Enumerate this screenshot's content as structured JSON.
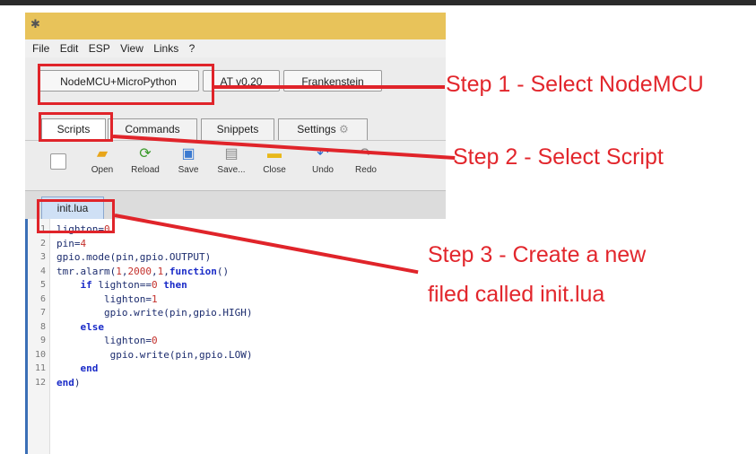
{
  "app": {
    "menu": [
      "File",
      "Edit",
      "ESP",
      "View",
      "Links",
      "?"
    ],
    "board_tabs": [
      "NodeMCU+MicroPython",
      "AT v0.20",
      "Frankenstein"
    ],
    "tabs": [
      "Scripts",
      "Commands",
      "Snippets",
      "Settings"
    ],
    "toolbar": [
      {
        "label": "Open",
        "icon": "open-folder-icon",
        "color": "#e8a51a"
      },
      {
        "label": "Reload",
        "icon": "reload-icon",
        "color": "#3a9a2a"
      },
      {
        "label": "Save",
        "icon": "save-icon",
        "color": "#3b7ad0"
      },
      {
        "label": "Save...",
        "icon": "save-as-icon",
        "color": "#888888"
      },
      {
        "label": "Close",
        "icon": "close-icon",
        "color": "#e8b81a"
      },
      {
        "label": "Undo",
        "icon": "undo-icon",
        "color": "#2a6ad0"
      },
      {
        "label": "Redo",
        "icon": "redo-icon",
        "color": "#888888"
      }
    ],
    "file_tab": "init.lua"
  },
  "code_lines": [
    {
      "n": "1",
      "text": "lighton=0"
    },
    {
      "n": "2",
      "text": "pin=4"
    },
    {
      "n": "3",
      "text": "gpio.mode(pin,gpio.OUTPUT)"
    },
    {
      "n": "4",
      "text": "tmr.alarm(1,2000,1,function()"
    },
    {
      "n": "5",
      "text": "    if lighton==0 then"
    },
    {
      "n": "6",
      "text": "        lighton=1"
    },
    {
      "n": "7",
      "text": "        gpio.write(pin,gpio.HIGH)"
    },
    {
      "n": "8",
      "text": "    else"
    },
    {
      "n": "9",
      "text": "        lighton=0"
    },
    {
      "n": "10",
      "text": "         gpio.write(pin,gpio.LOW)"
    },
    {
      "n": "11",
      "text": "    end"
    },
    {
      "n": "12",
      "text": "end)"
    }
  ],
  "annotations": {
    "step1": "Step 1 - Select NodeMCU",
    "step2": "Step 2 - Select Script",
    "step3_line1": "Step 3 - Create a new",
    "step3_line2": "filed called init.lua",
    "color": "#e0242a"
  }
}
